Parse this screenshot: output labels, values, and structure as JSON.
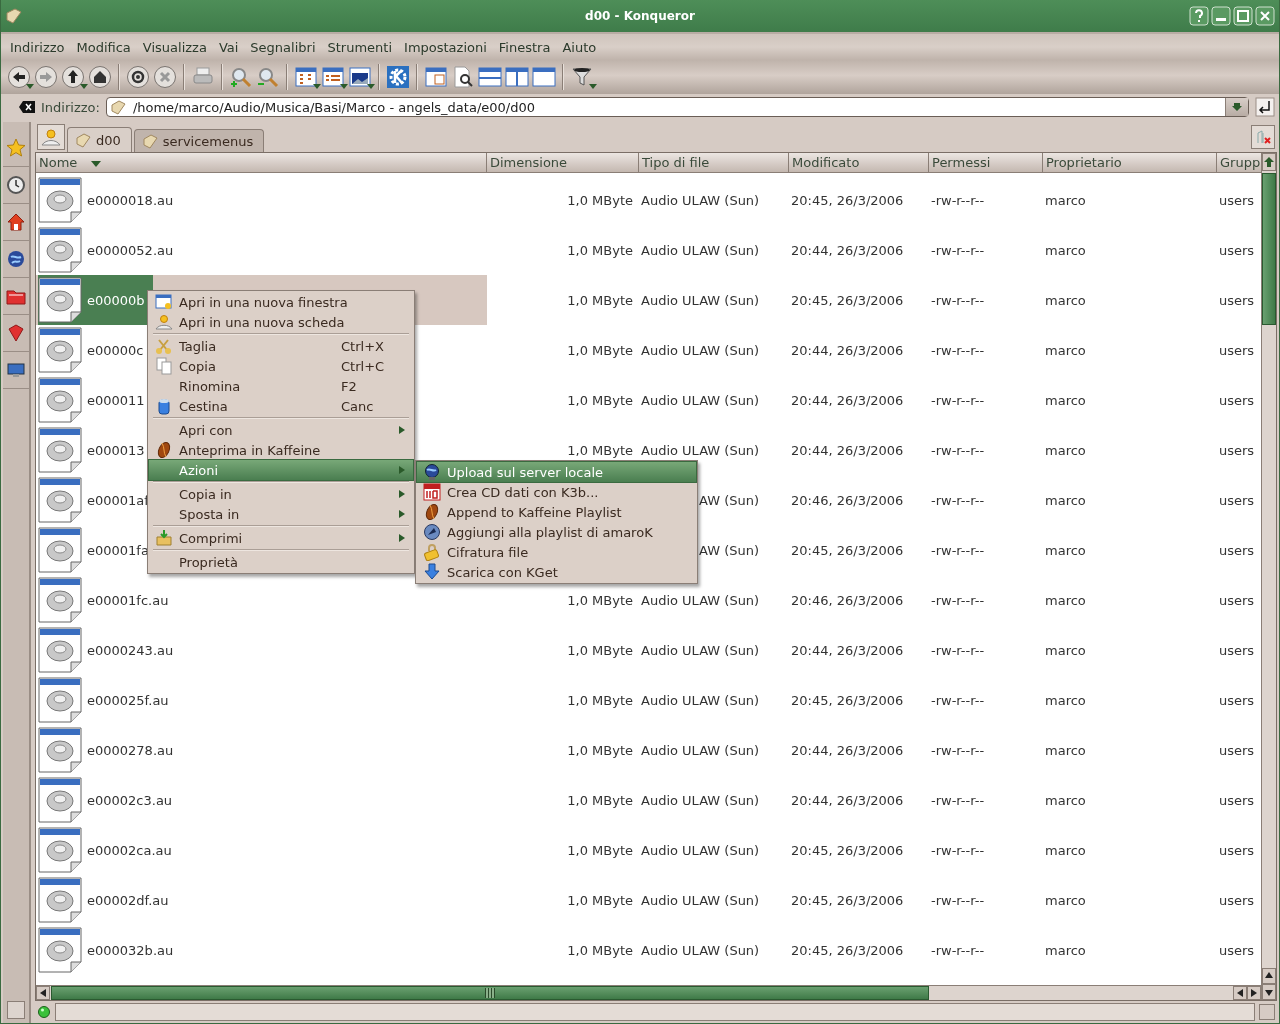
{
  "window": {
    "title": "d00 - Konqueror"
  },
  "menu_bar": [
    "Indirizzo",
    "Modifica",
    "Visualizza",
    "Vai",
    "Segnalibri",
    "Strumenti",
    "Impostazioni",
    "Finestra",
    "Aiuto"
  ],
  "location": {
    "label": "Indirizzo:",
    "value": "/home/marco/Audio/Musica/Basi/Marco - angels_data/e00/d00"
  },
  "tabs": [
    {
      "label": "d00",
      "selected": true
    },
    {
      "label": "servicemenus",
      "selected": false
    }
  ],
  "file_list": {
    "columns": [
      {
        "label": "Nome",
        "sorted": true
      },
      {
        "label": "Dimensione",
        "sorted": false
      },
      {
        "label": "Tipo di file",
        "sorted": false
      },
      {
        "label": "Modificato",
        "sorted": false
      },
      {
        "label": "Permessi",
        "sorted": false
      },
      {
        "label": "Proprietario",
        "sorted": false
      },
      {
        "label": "Grupp",
        "sorted": false
      }
    ],
    "rows": [
      {
        "kind": "full",
        "name": "e0000018.au",
        "size": "1,0 MByte",
        "type": "Audio ULAW (Sun)",
        "modified": "20:45, 26/3/2006",
        "permissions": "-rw-r--r--",
        "owner": "marco",
        "group": "users",
        "selected": false
      },
      {
        "kind": "full",
        "name": "e0000052.au",
        "size": "1,0 MByte",
        "type": "Audio ULAW (Sun)",
        "modified": "20:44, 26/3/2006",
        "permissions": "-rw-r--r--",
        "owner": "marco",
        "group": "users",
        "selected": false
      },
      {
        "kind": "full",
        "name": "e00000b",
        "size": "1,0 MByte",
        "type": "Audio ULAW (Sun)",
        "modified": "20:45, 26/3/2006",
        "permissions": "-rw-r--r--",
        "owner": "marco",
        "group": "users",
        "selected": true
      },
      {
        "kind": "full",
        "name": "e00000c",
        "size": "1,0 MByte",
        "type": "Audio ULAW (Sun)",
        "modified": "20:44, 26/3/2006",
        "permissions": "-rw-r--r--",
        "owner": "marco",
        "group": "users",
        "selected": false
      },
      {
        "kind": "full",
        "name": "e000011",
        "size": "1,0 MByte",
        "type": "Audio ULAW (Sun)",
        "modified": "20:44, 26/3/2006",
        "permissions": "-rw-r--r--",
        "owner": "marco",
        "group": "users",
        "selected": false
      },
      {
        "kind": "full",
        "name": "e000013",
        "size": "1,0 MByte",
        "type": "Audio ULAW (Sun)",
        "modified": "20:44, 26/3/2006",
        "permissions": "-rw-r--r--",
        "owner": "marco",
        "group": "users",
        "selected": false
      },
      {
        "kind": "covered",
        "name": "e00001af",
        "type": "AW (Sun)",
        "modified": "20:46, 26/3/2006",
        "permissions": "-rw-r--r--",
        "owner": "marco",
        "group": "users",
        "selected": false
      },
      {
        "kind": "covered",
        "name": "e00001fa",
        "type": "AW (Sun)",
        "modified": "20:45, 26/3/2006",
        "permissions": "-rw-r--r--",
        "owner": "marco",
        "group": "users",
        "selected": false
      },
      {
        "kind": "full",
        "name": "e00001fc.au",
        "size": "1,0 MByte",
        "type": "Audio ULAW (Sun)",
        "modified": "20:46, 26/3/2006",
        "permissions": "-rw-r--r--",
        "owner": "marco",
        "group": "users",
        "selected": false
      },
      {
        "kind": "full",
        "name": "e0000243.au",
        "size": "1,0 MByte",
        "type": "Audio ULAW (Sun)",
        "modified": "20:44, 26/3/2006",
        "permissions": "-rw-r--r--",
        "owner": "marco",
        "group": "users",
        "selected": false
      },
      {
        "kind": "full",
        "name": "e000025f.au",
        "size": "1,0 MByte",
        "type": "Audio ULAW (Sun)",
        "modified": "20:45, 26/3/2006",
        "permissions": "-rw-r--r--",
        "owner": "marco",
        "group": "users",
        "selected": false
      },
      {
        "kind": "full",
        "name": "e0000278.au",
        "size": "1,0 MByte",
        "type": "Audio ULAW (Sun)",
        "modified": "20:44, 26/3/2006",
        "permissions": "-rw-r--r--",
        "owner": "marco",
        "group": "users",
        "selected": false
      },
      {
        "kind": "full",
        "name": "e00002c3.au",
        "size": "1,0 MByte",
        "type": "Audio ULAW (Sun)",
        "modified": "20:44, 26/3/2006",
        "permissions": "-rw-r--r--",
        "owner": "marco",
        "group": "users",
        "selected": false
      },
      {
        "kind": "full",
        "name": "e00002ca.au",
        "size": "1,0 MByte",
        "type": "Audio ULAW (Sun)",
        "modified": "20:45, 26/3/2006",
        "permissions": "-rw-r--r--",
        "owner": "marco",
        "group": "users",
        "selected": false
      },
      {
        "kind": "full",
        "name": "e00002df.au",
        "size": "1,0 MByte",
        "type": "Audio ULAW (Sun)",
        "modified": "20:45, 26/3/2006",
        "permissions": "-rw-r--r--",
        "owner": "marco",
        "group": "users",
        "selected": false
      },
      {
        "kind": "full",
        "name": "e000032b.au",
        "size": "1,0 MByte",
        "type": "Audio ULAW (Sun)",
        "modified": "20:45, 26/3/2006",
        "permissions": "-rw-r--r--",
        "owner": "marco",
        "group": "users",
        "selected": false
      }
    ]
  },
  "context_menu": {
    "items": [
      {
        "kind": "item",
        "label": "Apri in una nuova finestra",
        "submenu": false,
        "selected": false
      },
      {
        "kind": "item",
        "label": "Apri in una nuova scheda",
        "submenu": false,
        "selected": false
      },
      {
        "kind": "separator"
      },
      {
        "kind": "item",
        "label": "Taglia",
        "shortcut": "Ctrl+X",
        "submenu": false,
        "selected": false
      },
      {
        "kind": "item",
        "label": "Copia",
        "shortcut": "Ctrl+C",
        "submenu": false,
        "selected": false
      },
      {
        "kind": "item",
        "label": "Rinomina",
        "shortcut": "F2",
        "submenu": false,
        "selected": false
      },
      {
        "kind": "item",
        "label": "Cestina",
        "shortcut": "Canc",
        "submenu": false,
        "selected": false
      },
      {
        "kind": "separator"
      },
      {
        "kind": "item",
        "label": "Apri con",
        "submenu": true,
        "selected": false
      },
      {
        "kind": "item",
        "label": "Anteprima in Kaffeine",
        "submenu": false,
        "selected": false
      },
      {
        "kind": "item",
        "label": "Azioni",
        "submenu": true,
        "selected": true
      },
      {
        "kind": "separator"
      },
      {
        "kind": "item",
        "label": "Copia in",
        "submenu": true,
        "selected": false
      },
      {
        "kind": "item",
        "label": "Sposta in",
        "submenu": true,
        "selected": false
      },
      {
        "kind": "separator"
      },
      {
        "kind": "item",
        "label": "Comprimi",
        "submenu": true,
        "selected": false
      },
      {
        "kind": "separator"
      },
      {
        "kind": "item",
        "label": "Proprietà",
        "submenu": false,
        "selected": false
      }
    ]
  },
  "submenu": {
    "items": [
      {
        "kind": "item",
        "label": "Upload sul server locale",
        "submenu": false,
        "selected": true
      },
      {
        "kind": "item",
        "label": "Crea CD dati con K3b...",
        "submenu": false,
        "selected": false
      },
      {
        "kind": "item",
        "label": "Append to Kaffeine Playlist",
        "submenu": false,
        "selected": false
      },
      {
        "kind": "item",
        "label": "Aggiungi alla playlist di amaroK",
        "submenu": false,
        "selected": false
      },
      {
        "kind": "item",
        "label": "Cifratura file",
        "submenu": false,
        "selected": false
      },
      {
        "kind": "item",
        "label": "Scarica con KGet",
        "submenu": false,
        "selected": false
      }
    ]
  }
}
